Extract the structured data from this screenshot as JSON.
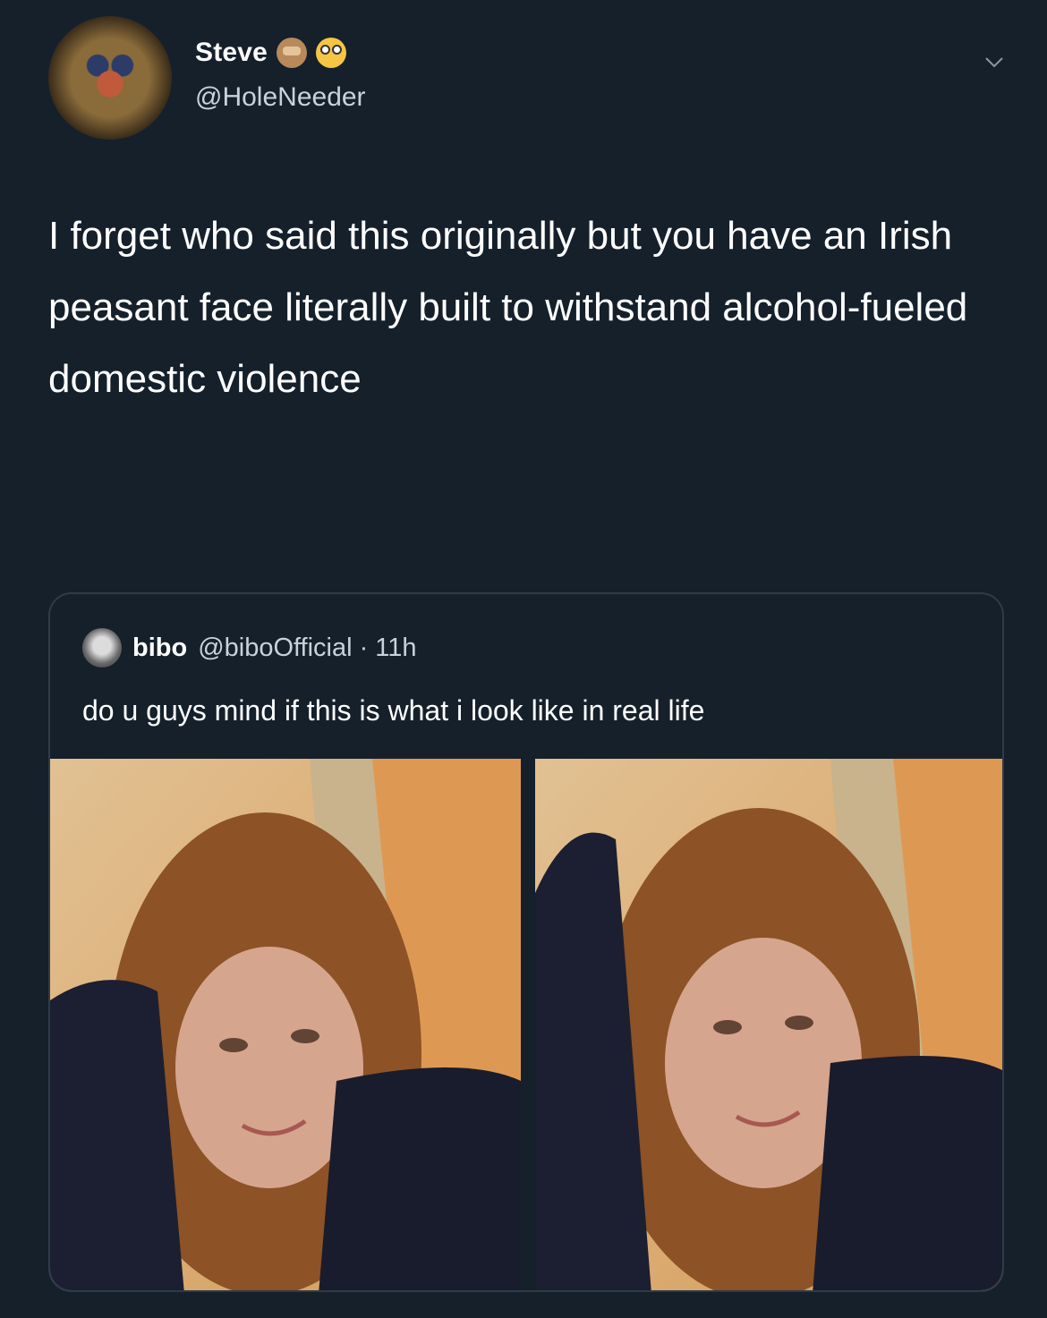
{
  "tweet": {
    "display_name": "Steve",
    "emojis": [
      "see-no-evil-monkey",
      "flushed-face"
    ],
    "handle": "@HoleNeeder",
    "text": "I forget who said this originally but you have an Irish peasant face literally built to withstand alcohol-fueled domestic violence"
  },
  "quoted_tweet": {
    "display_name": "bibo",
    "handle": "@biboOfficial",
    "separator": "·",
    "time": "11h",
    "text": "do u guys mind if this is what i look like in real life",
    "photos": [
      "selfie-photo-1",
      "selfie-photo-2"
    ]
  },
  "colors": {
    "background": "#15202b",
    "border": "#2f3b47",
    "secondary_text": "#c9d2da"
  }
}
